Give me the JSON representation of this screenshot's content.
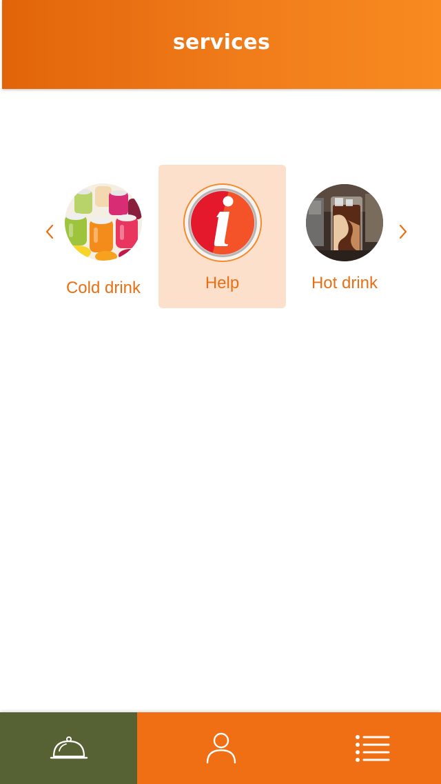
{
  "header": {
    "title": "services"
  },
  "carousel": {
    "prev_icon": "chevron-left-icon",
    "next_icon": "chevron-right-icon",
    "items": [
      {
        "label": "Cold drink",
        "image": "cold-drink-jars-image"
      },
      {
        "label": "Help",
        "image": "info-icon",
        "selected": true
      },
      {
        "label": "Hot drink",
        "image": "iced-coffee-glass-image"
      }
    ]
  },
  "bottom_nav": {
    "items": [
      {
        "icon": "cloche-icon",
        "active": true
      },
      {
        "icon": "user-icon",
        "active": false
      },
      {
        "icon": "list-menu-icon",
        "active": false
      }
    ]
  },
  "colors": {
    "accent": "#f06e14",
    "header_start": "#e2640a",
    "header_end": "#f88a20",
    "label_text": "#e96f14",
    "selected_card_bg": "#fde0cc",
    "nav_active_bg": "#566234",
    "info_red": "#e4192b"
  }
}
